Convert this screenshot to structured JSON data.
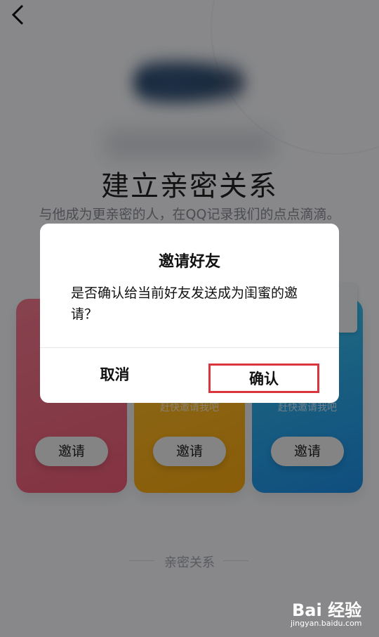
{
  "header": {
    "back_icon": "chevron-left-icon"
  },
  "main": {
    "title": "建立亲密关系",
    "subtitle": "与他成为更亲密的人，在QQ记录我们的点点滴滴。"
  },
  "cards": [
    {
      "line1": "",
      "line2": "",
      "button": "邀请",
      "color": "#f06a82"
    },
    {
      "line1": "",
      "line2": "赶快邀请我吧",
      "button": "邀请",
      "color": "#fbb525"
    },
    {
      "line1": "",
      "line2": "赶快邀请我吧",
      "button": "邀请",
      "color": "#2aa8ea"
    }
  ],
  "footer": {
    "label": "亲密关系"
  },
  "watermark": {
    "brand": "Bai 经验",
    "sub": "jingyan.baidu.com"
  },
  "dialog": {
    "title": "邀请好友",
    "message": "是否确认给当前好友发送成为闺蜜的邀请？",
    "cancel_label": "取消",
    "confirm_label": "确认",
    "highlight_color": "#d9363e"
  }
}
